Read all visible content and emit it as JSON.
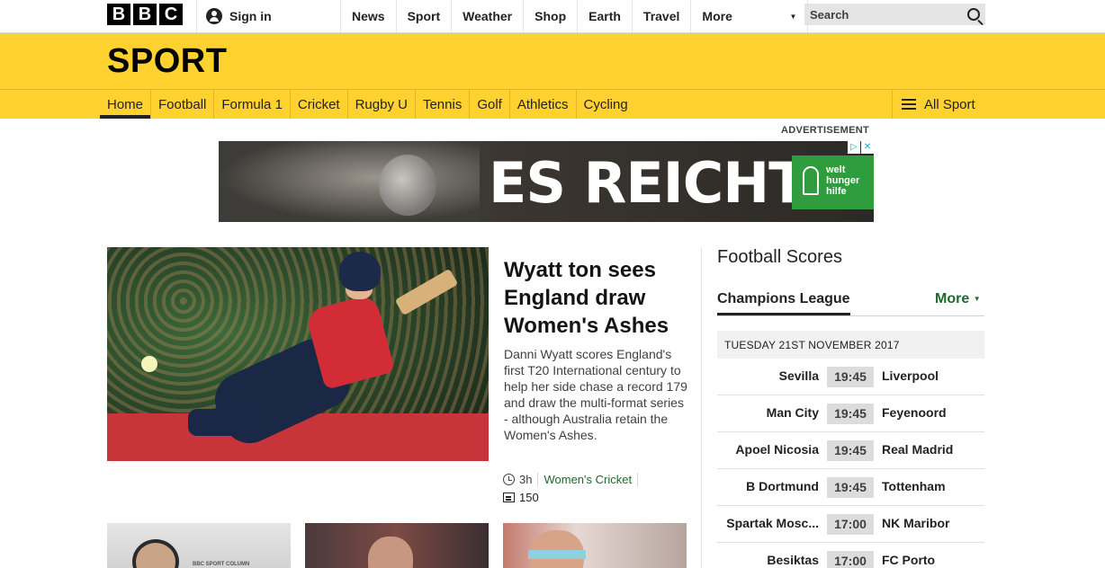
{
  "header": {
    "logo_letters": [
      "B",
      "B",
      "C"
    ],
    "sign_in": "Sign in",
    "nav": [
      "News",
      "Sport",
      "Weather",
      "Shop",
      "Earth",
      "Travel"
    ],
    "more": "More",
    "search_placeholder": "Search"
  },
  "sport": {
    "title": "SPORT",
    "nav": [
      "Home",
      "Football",
      "Formula 1",
      "Cricket",
      "Rugby U",
      "Tennis",
      "Golf",
      "Athletics",
      "Cycling"
    ],
    "active_index": 0,
    "all_sport": "All Sport"
  },
  "advert": {
    "label": "ADVERTISEMENT",
    "headline": "ES REICHT!",
    "logo_text": [
      "welt",
      "hunger",
      "hilfe"
    ],
    "adchoices": [
      "▷",
      "✕"
    ]
  },
  "main_story": {
    "title": "Wyatt ton sees England draw Women's Ashes",
    "summary": "Danni Wyatt scores England's first T20 International century to help her side chase a record 179 and draw the multi-format series - although Australia retain the Women's Ashes.",
    "time": "3h",
    "topic": "Women's Cricket",
    "comments": "150"
  },
  "thumbnails": {
    "thumb1_caption": "BBC SPORT COLUMN"
  },
  "scores": {
    "title": "Football Scores",
    "competition": "Champions League",
    "more": "More",
    "date": "TUESDAY 21ST NOVEMBER 2017",
    "matches": [
      {
        "home": "Sevilla",
        "time": "19:45",
        "away": "Liverpool"
      },
      {
        "home": "Man City",
        "time": "19:45",
        "away": "Feyenoord"
      },
      {
        "home": "Apoel Nicosia",
        "time": "19:45",
        "away": "Real Madrid"
      },
      {
        "home": "B Dortmund",
        "time": "19:45",
        "away": "Tottenham"
      },
      {
        "home": "Spartak Mosc...",
        "time": "17:00",
        "away": "NK Maribor"
      },
      {
        "home": "Besiktas",
        "time": "17:00",
        "away": "FC Porto"
      }
    ]
  },
  "colors": {
    "sport_yellow": "#ffd230",
    "link_green": "#1e6a2c",
    "advert_green": "#2f9c3e"
  }
}
